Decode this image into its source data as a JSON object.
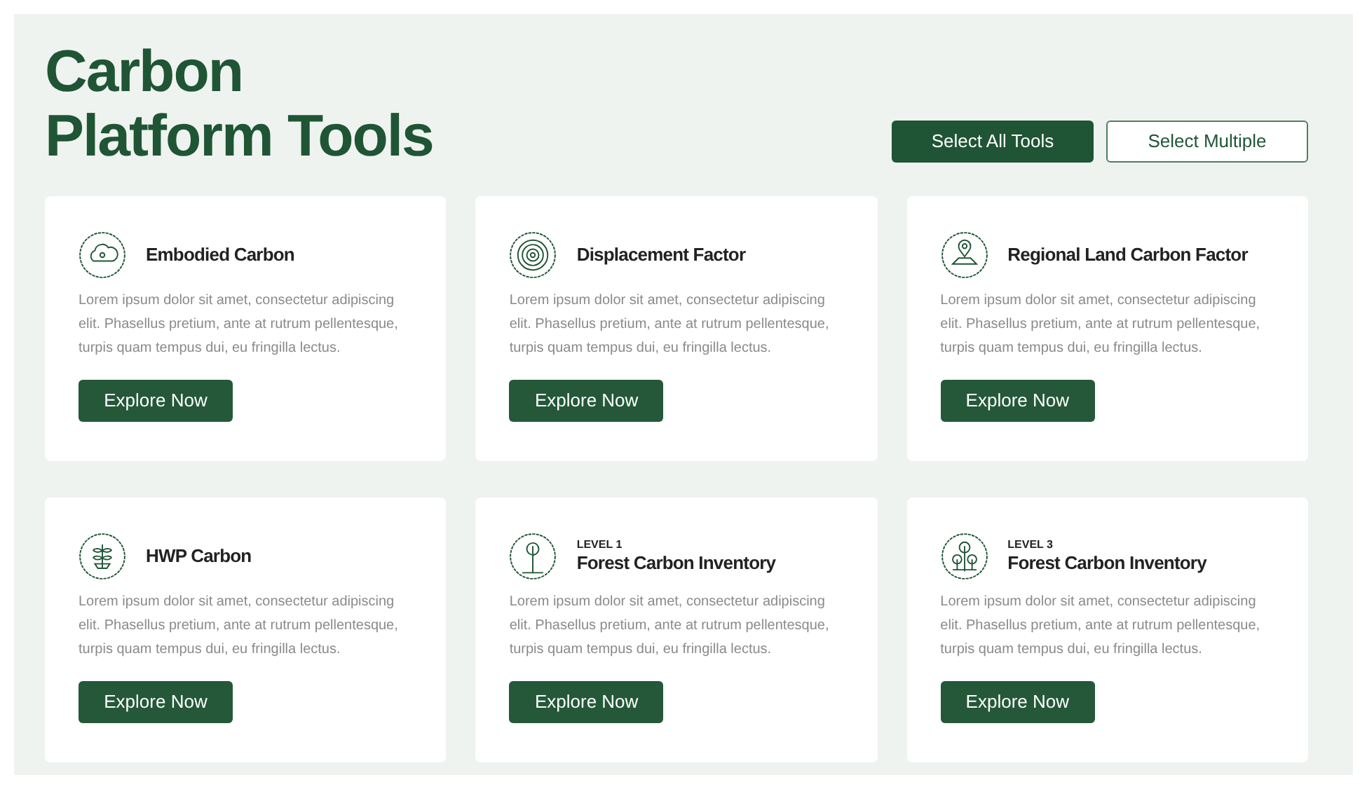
{
  "title_lines": [
    "Carbon",
    "Platform Tools"
  ],
  "actions": [
    {
      "label": "Select All Tools",
      "kind": "primary"
    },
    {
      "label": "Select Multiple",
      "kind": "outline"
    }
  ],
  "tools": [
    {
      "kind": "co2",
      "name": "Embodied Carbon",
      "description": "Lorem ipsum dolor sit amet, consectetur adipiscing elit. Phasellus pretium, ante at rutrum pellentesque, turpis quam tempus dui, eu fringilla lectus.",
      "button": "Explore Now"
    },
    {
      "kind": "rings",
      "name": "Displacement Factor",
      "description": "Lorem ipsum dolor sit amet, consectetur adipiscing elit. Phasellus pretium, ante at rutrum pellentesque, turpis quam tempus dui, eu fringilla lectus.",
      "button": "Explore Now"
    },
    {
      "kind": "map",
      "name": "Regional Land Carbon Factor",
      "description": "Lorem ipsum dolor sit amet, consectetur adipiscing elit. Phasellus pretium, ante at rutrum pellentesque, turpis quam tempus dui, eu fringilla lectus.",
      "button": "Explore Now"
    },
    {
      "kind": "plant",
      "name": "HWP Carbon",
      "description": "Lorem ipsum dolor sit amet, consectetur adipiscing elit. Phasellus pretium, ante at rutrum pellentesque, turpis quam tempus dui, eu fringilla lectus.",
      "button": "Explore Now"
    },
    {
      "kind": "tree",
      "eyebrow": "LEVEL 1",
      "name": "Forest Carbon Inventory",
      "description": "Lorem ipsum dolor sit amet, consectetur adipiscing elit. Phasellus pretium, ante at rutrum pellentesque, turpis quam tempus dui, eu fringilla lectus.",
      "button": "Explore Now"
    },
    {
      "kind": "trees",
      "eyebrow": "LEVEL 3",
      "name": "Forest Carbon Inventory",
      "description": "Lorem ipsum dolor sit amet, consectetur adipiscing elit. Phasellus pretium, ante at rutrum pellentesque, turpis quam tempus dui, eu fringilla lectus.",
      "button": "Explore Now"
    }
  ]
}
